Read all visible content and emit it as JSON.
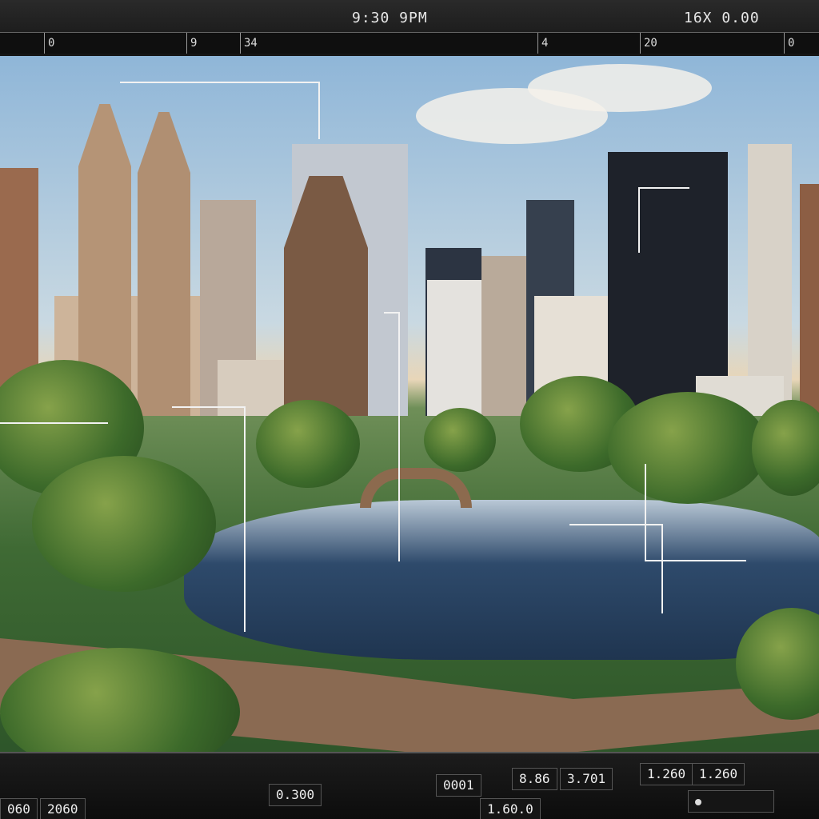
{
  "topbar": {
    "time_readout": "9:30  9PM",
    "zoom_readout": "16X  0.00",
    "ruler_ticks": [
      "0",
      "9",
      "34",
      "4",
      "20",
      "0"
    ]
  },
  "bottombar": {
    "values_row1": [
      "0.300",
      "0001",
      "8.86",
      "3.701",
      "1.260"
    ],
    "values_row2": [
      "1.60.0"
    ],
    "left_values": [
      "060",
      "2060"
    ]
  },
  "colors": {
    "accent": "#f2f2f2",
    "bar_bg": "#141414"
  },
  "icons": [
    "record-dot-icon"
  ]
}
